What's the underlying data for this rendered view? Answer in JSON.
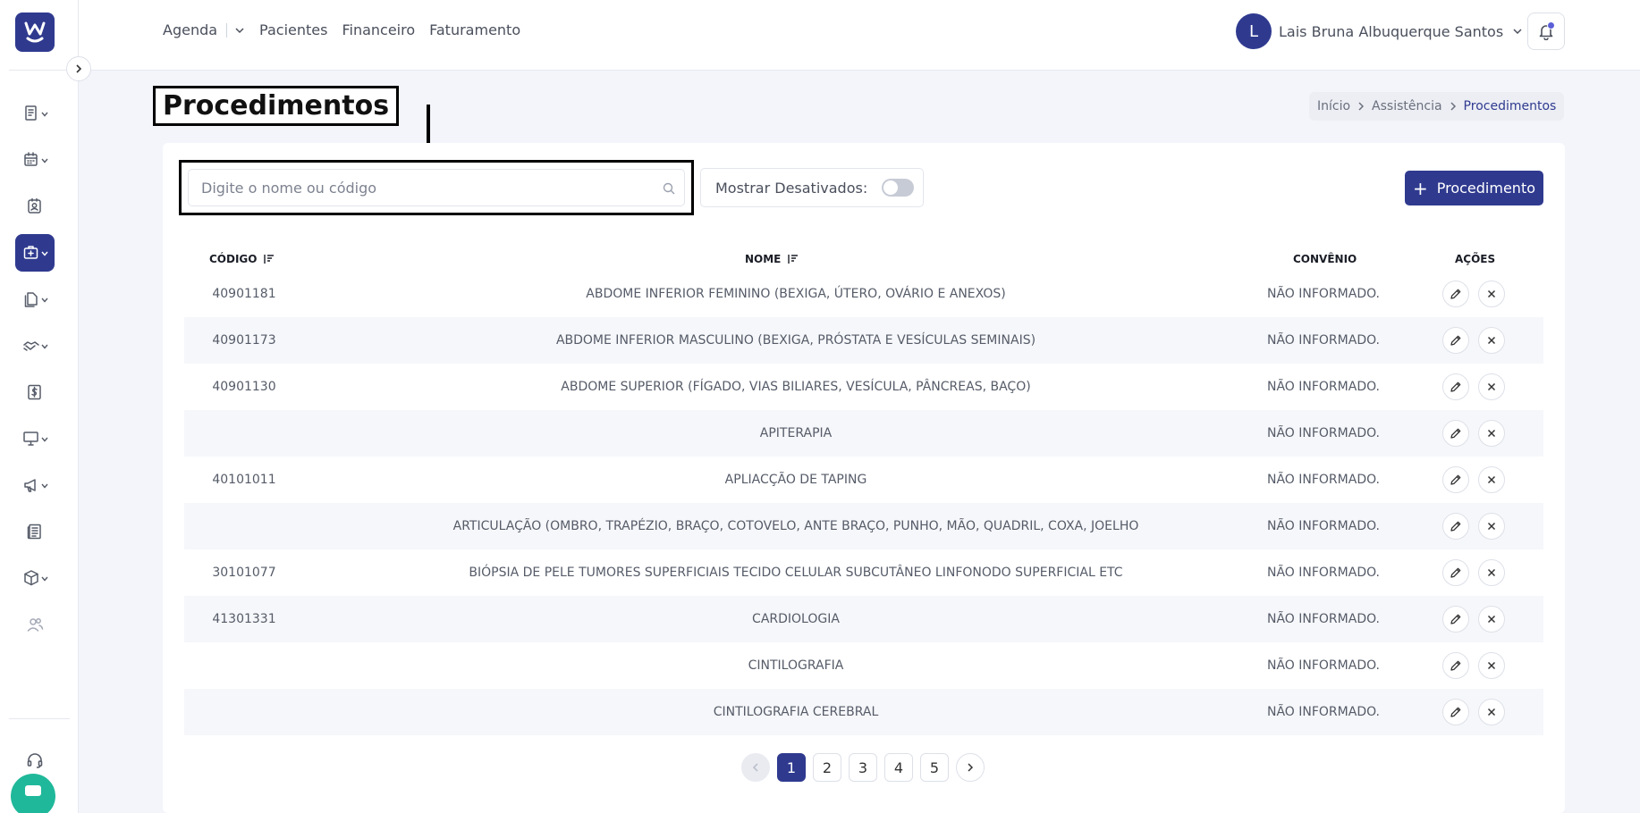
{
  "sidebar": {
    "logo_icon": "w-smile-logo",
    "items": [
      {
        "name": "receipt-icon",
        "has_chevron": true,
        "active": false
      },
      {
        "name": "calendar-icon",
        "has_chevron": true,
        "active": false
      },
      {
        "name": "contact-card-icon",
        "has_chevron": false,
        "active": false
      },
      {
        "name": "medical-kit-icon",
        "has_chevron": true,
        "active": true
      },
      {
        "name": "documents-icon",
        "has_chevron": true,
        "active": false
      },
      {
        "name": "handshake-icon",
        "has_chevron": true,
        "active": false
      },
      {
        "name": "dollar-icon",
        "has_chevron": false,
        "active": false
      },
      {
        "name": "monitor-icon",
        "has_chevron": true,
        "active": false
      },
      {
        "name": "megaphone-icon",
        "has_chevron": true,
        "active": false
      },
      {
        "name": "news-icon",
        "has_chevron": false,
        "active": false
      },
      {
        "name": "box-icon",
        "has_chevron": true,
        "active": false
      },
      {
        "name": "users-icon",
        "has_chevron": false,
        "active": false
      }
    ],
    "support_icon": "headset-icon"
  },
  "header": {
    "nav": [
      "Agenda",
      "Pacientes",
      "Financeiro",
      "Faturamento"
    ],
    "user_initial": "L",
    "user_name": "Lais Bruna Albuquerque Santos"
  },
  "page": {
    "title": "Procedimentos",
    "breadcrumb": [
      "Início",
      "Assistência",
      "Procedimentos"
    ]
  },
  "toolbar": {
    "search_placeholder": "Digite o nome ou código",
    "search_value": "",
    "toggle_label": "Mostrar Desativados:",
    "toggle_on": false,
    "add_label": "Procedimento"
  },
  "table": {
    "columns": [
      "CÓDIGO",
      "NOME",
      "CONVÊNIO",
      "AÇÕES"
    ],
    "rows": [
      {
        "code": "40901181",
        "name": "ABDOME INFERIOR FEMININO (BEXIGA, ÚTERO, OVÁRIO E ANEXOS)",
        "convenio": "NÃO INFORMADO."
      },
      {
        "code": "40901173",
        "name": "ABDOME INFERIOR MASCULINO (BEXIGA, PRÓSTATA E VESÍCULAS SEMINAIS)",
        "convenio": "NÃO INFORMADO."
      },
      {
        "code": "40901130",
        "name": "ABDOME SUPERIOR (FÍGADO, VIAS BILIARES, VESÍCULA, PÂNCREAS, BAÇO)",
        "convenio": "NÃO INFORMADO."
      },
      {
        "code": "",
        "name": "APITERAPIA",
        "convenio": "NÃO INFORMADO."
      },
      {
        "code": "40101011",
        "name": "APLIACÇÃO DE TAPING",
        "convenio": "NÃO INFORMADO."
      },
      {
        "code": "",
        "name": "ARTICULAÇÃO (OMBRO, TRAPÉZIO, BRAÇO, COTOVELO, ANTE BRAÇO, PUNHO, MÃO, QUADRIL, COXA, JOELHO",
        "convenio": "NÃO INFORMADO."
      },
      {
        "code": "30101077",
        "name": "BIÓPSIA DE PELE TUMORES SUPERFICIAIS TECIDO CELULAR SUBCUTÂNEO LINFONODO SUPERFICIAL ETC",
        "convenio": "NÃO INFORMADO."
      },
      {
        "code": "41301331",
        "name": "CARDIOLOGIA",
        "convenio": "NÃO INFORMADO."
      },
      {
        "code": "",
        "name": "CINTILOGRAFIA",
        "convenio": "NÃO INFORMADO."
      },
      {
        "code": "",
        "name": "CINTILOGRAFIA CEREBRAL",
        "convenio": "NÃO INFORMADO."
      }
    ]
  },
  "pagination": {
    "pages": [
      "1",
      "2",
      "3",
      "4",
      "5"
    ],
    "current": "1"
  },
  "colors": {
    "primary": "#2f3a8f",
    "support_bubble": "#1fb89a"
  }
}
